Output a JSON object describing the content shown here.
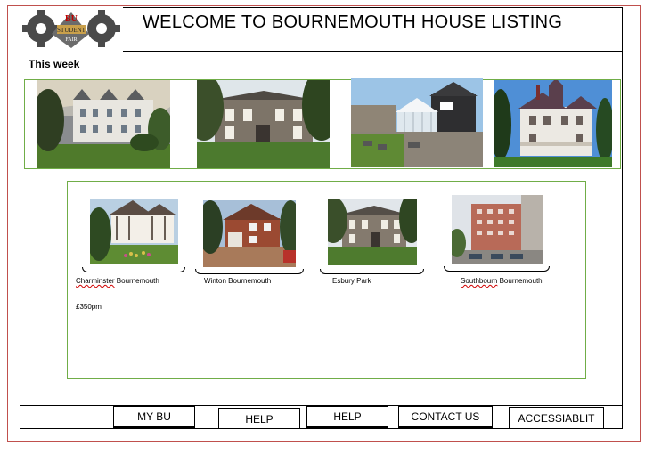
{
  "header": {
    "title": "WELCOME TO BOURNEMOUTH HOUSE LISTING",
    "logo_text": {
      "line1": "BU",
      "line2": "STUDENT",
      "line3": "FAIR"
    }
  },
  "featured": {
    "heading": "This week",
    "photos": [
      {
        "name": "white-terrace-house"
      },
      {
        "name": "stone-manor-house"
      },
      {
        "name": "modern-house-with-conservatory"
      },
      {
        "name": "victorian-turret-house"
      }
    ]
  },
  "listings": [
    {
      "location": "Charminster Bournemouth",
      "misspelled": "Charminster",
      "rest": " Bournemouth"
    },
    {
      "location": "Winton Bournemouth"
    },
    {
      "location": "Esbury Park"
    },
    {
      "location": "Southbourn Bournemouth",
      "misspelled": "Southbourn",
      "rest": " Bournemouth"
    }
  ],
  "price": "£350pm",
  "footer_nav": [
    {
      "label": "MY BU"
    },
    {
      "label": "HELP"
    },
    {
      "label": "HELP"
    },
    {
      "label": "CONTACT US"
    },
    {
      "label": "ACCESSIABLIT"
    }
  ],
  "colors": {
    "frame_border": "#c0504d",
    "panel_border": "#70ad47",
    "text": "#000000"
  }
}
